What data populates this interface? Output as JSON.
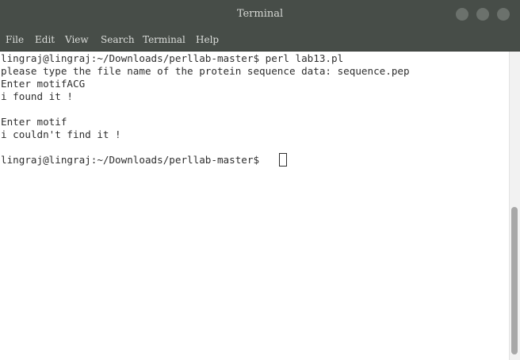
{
  "window": {
    "title": "Terminal"
  },
  "menu": {
    "items": [
      "File",
      "Edit",
      "View",
      "Search",
      "Terminal",
      "Help"
    ]
  },
  "terminal": {
    "lines": [
      "lingraj@lingraj:~/Downloads/perllab-master$ perl lab13.pl",
      "please type the file name of the protein sequence data: sequence.pep",
      "Enter motifACG",
      "i found it !",
      "",
      "Enter motif",
      "i couldn't find it !",
      "",
      "lingraj@lingraj:~/Downloads/perllab-master$ "
    ]
  },
  "colors": {
    "titlebar_bg": "#474d48",
    "title_text": "#d6d8d4",
    "terminal_bg": "#ffffff",
    "terminal_text": "#2e2e2e",
    "window_button": "#6b716c"
  }
}
